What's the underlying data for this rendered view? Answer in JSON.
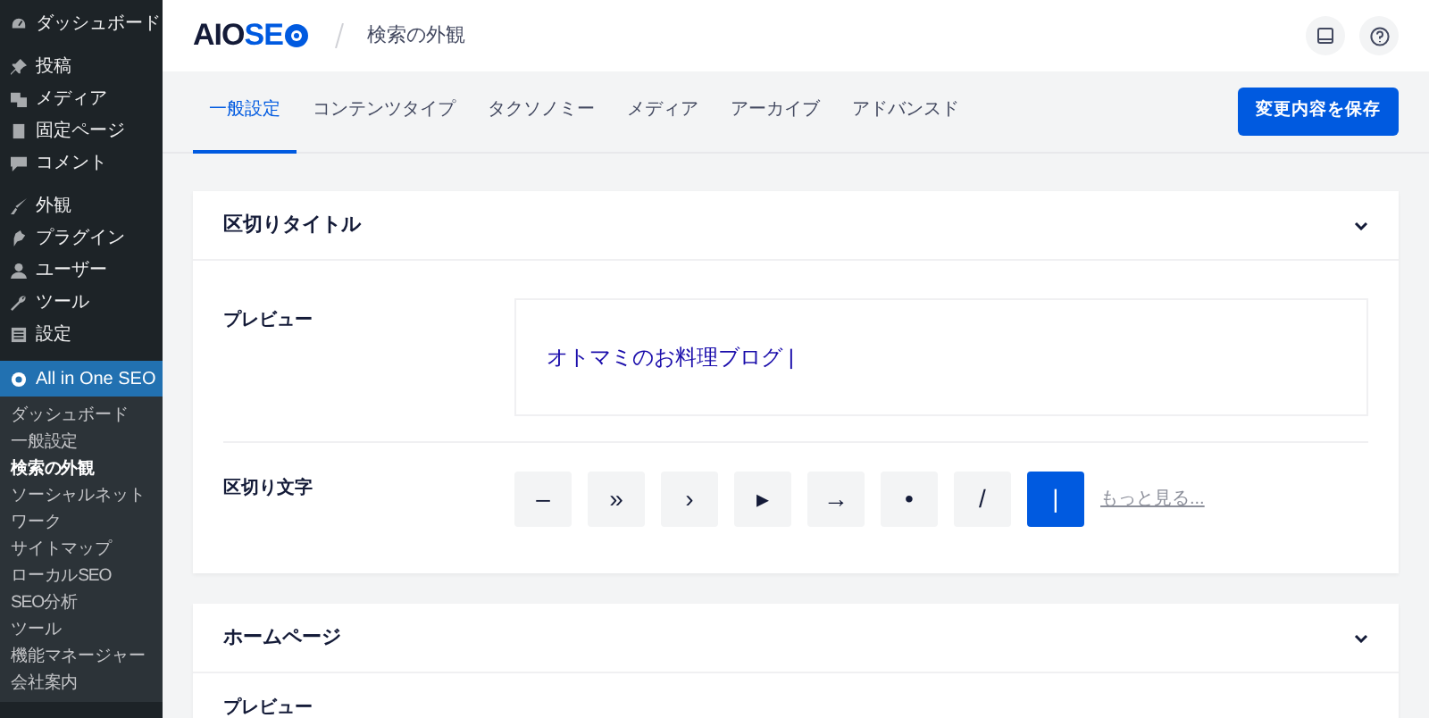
{
  "sidebar": {
    "menu": [
      {
        "label": "ダッシュボード",
        "selected": false
      },
      {
        "label": "投稿",
        "selected": false
      },
      {
        "label": "メディア",
        "selected": false
      },
      {
        "label": "固定ページ",
        "selected": false
      },
      {
        "label": "コメント",
        "selected": false
      },
      {
        "label": "外観",
        "selected": false
      },
      {
        "label": "プラグイン",
        "selected": false
      },
      {
        "label": "ユーザー",
        "selected": false
      },
      {
        "label": "ツール",
        "selected": false
      },
      {
        "label": "設定",
        "selected": false
      },
      {
        "label": "All in One SEO",
        "selected": true
      }
    ],
    "submenu": [
      {
        "label": "ダッシュボード",
        "selected": false
      },
      {
        "label": "一般設定",
        "selected": false
      },
      {
        "label": "検索の外観",
        "selected": true
      },
      {
        "label": "ソーシャルネットワーク",
        "selected": false
      },
      {
        "label": "サイトマップ",
        "selected": false
      },
      {
        "label": "ローカルSEO",
        "selected": false
      },
      {
        "label": "SEO分析",
        "selected": false
      },
      {
        "label": "ツール",
        "selected": false
      },
      {
        "label": "機能マネージャー",
        "selected": false
      },
      {
        "label": "会社案内",
        "selected": false
      }
    ]
  },
  "header": {
    "logo_dark": "AIO",
    "logo_accent": "SE",
    "page_title": "検索の外観"
  },
  "tabs": [
    {
      "label": "一般設定",
      "selected": true
    },
    {
      "label": "コンテンツタイプ",
      "selected": false
    },
    {
      "label": "タクソノミー",
      "selected": false
    },
    {
      "label": "メディア",
      "selected": false
    },
    {
      "label": "アーカイブ",
      "selected": false
    },
    {
      "label": "アドバンスド",
      "selected": false
    }
  ],
  "save_button": "変更内容を保存",
  "cards": [
    {
      "title": "区切りタイトル",
      "preview_label": "プレビュー",
      "preview_text": "オトマミのお料理ブログ |",
      "separator_label": "区切り文字",
      "separators": [
        {
          "label": "–",
          "selected": false
        },
        {
          "label": "»",
          "selected": false
        },
        {
          "label": "›",
          "selected": false
        },
        {
          "label": "▸",
          "selected": false
        },
        {
          "label": "→",
          "selected": false
        },
        {
          "label": "•",
          "selected": false
        },
        {
          "label": "/",
          "selected": false
        },
        {
          "label": "|",
          "selected": true
        }
      ],
      "more_link": "もっと見る..."
    },
    {
      "title": "ホームページ",
      "preview_label": "プレビュー"
    }
  ]
}
